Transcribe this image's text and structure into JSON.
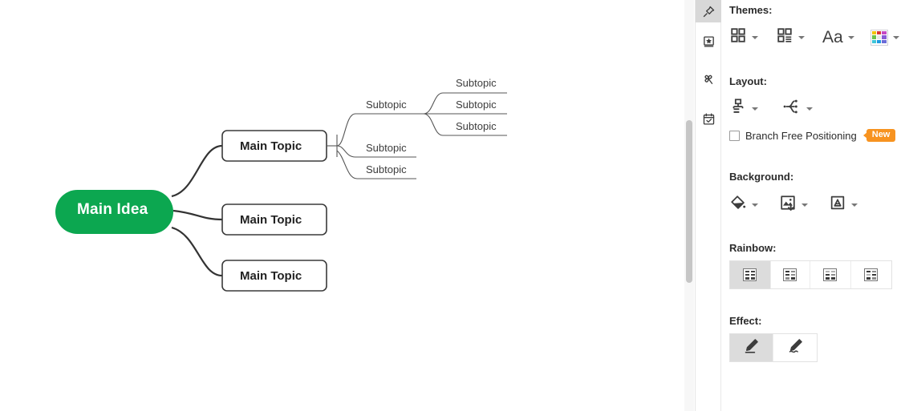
{
  "canvas": {
    "name": "mind-map-canvas",
    "center_node": {
      "label": "Main Idea",
      "fill": "#0ca750",
      "text_color": "#ffffff"
    },
    "main_topics": [
      {
        "label": "Main Topic"
      },
      {
        "label": "Main Topic"
      },
      {
        "label": "Main Topic"
      }
    ],
    "subtopics_level1": [
      {
        "label": "Subtopic"
      },
      {
        "label": "Subtopic"
      },
      {
        "label": "Subtopic"
      }
    ],
    "subtopics_level2": [
      {
        "label": "Subtopic"
      },
      {
        "label": "Subtopic"
      },
      {
        "label": "Subtopic"
      }
    ],
    "scrollbar": {
      "name": "canvas-vertical-scrollbar"
    }
  },
  "icon_rail": {
    "items": [
      {
        "icon": "pushpin-icon",
        "name": "rail-item-style",
        "active": true
      },
      {
        "icon": "book-star-icon",
        "name": "rail-item-outline",
        "active": false
      },
      {
        "icon": "clover-icon",
        "name": "rail-item-clipart",
        "active": false
      },
      {
        "icon": "calendar-check-icon",
        "name": "rail-item-task",
        "active": false
      }
    ]
  },
  "panel": {
    "themes": {
      "title": "Themes:",
      "items": [
        {
          "name": "theme-gallery",
          "icon": "four-squares-icon"
        },
        {
          "name": "theme-layout-variant",
          "icon": "squares-lines-icon"
        },
        {
          "name": "theme-font",
          "icon": "aa-icon",
          "label": "Aa"
        },
        {
          "name": "theme-color-palette",
          "icon": "color-palette-icon"
        }
      ],
      "palette_colors": [
        "#f2c200",
        "#d8363a",
        "#c648c4",
        "#6cc24a",
        "#e8e8e8",
        "#8a5ad6",
        "#3fc6d8",
        "#1f9ae0",
        "#6b6bd8"
      ]
    },
    "layout": {
      "title": "Layout:",
      "items": [
        {
          "name": "layout-structure",
          "icon": "org-chart-icon"
        },
        {
          "name": "layout-branch-shape",
          "icon": "tree-branch-icon"
        }
      ],
      "branch_free_positioning": {
        "label": "Branch Free Positioning",
        "checked": false,
        "badge": "New",
        "badge_color": "#f79320"
      }
    },
    "background": {
      "title": "Background:",
      "items": [
        {
          "name": "background-fill-color",
          "icon": "paint-bucket-icon"
        },
        {
          "name": "background-image",
          "icon": "image-download-icon"
        },
        {
          "name": "background-watermark",
          "icon": "watermark-icon"
        }
      ]
    },
    "rainbow": {
      "title": "Rainbow:",
      "options": [
        {
          "name": "rainbow-option-1",
          "icon": "grid-dark-icon",
          "active": true,
          "cells": [
            "#444444",
            "#444444",
            "#444444",
            "#444444",
            "#444444",
            "#444444"
          ]
        },
        {
          "name": "rainbow-option-2",
          "icon": "grid-mixed-a-icon",
          "active": false,
          "cells": [
            "#3a3a3a",
            "#8c8c8c",
            "#3a3a3a",
            "#8c8c8c",
            "#8c8c8c",
            "#3a3a3a"
          ]
        },
        {
          "name": "rainbow-option-3",
          "icon": "grid-mixed-b-icon",
          "active": false,
          "cells": [
            "#b4b4b4",
            "#b4b4b4",
            "#3a3a3a",
            "#8c8c8c",
            "#3a3a3a",
            "#3a3a3a"
          ]
        },
        {
          "name": "rainbow-option-4",
          "icon": "grid-mixed-c-icon",
          "active": false,
          "cells": [
            "#3a3a3a",
            "#8c8c8c",
            "#b4b4b4",
            "#3a3a3a",
            "#3a3a3a",
            "#8c8c8c"
          ]
        }
      ]
    },
    "effect": {
      "title": "Effect:",
      "options": [
        {
          "name": "effect-straight-line",
          "icon": "pencil-line-icon",
          "active": true
        },
        {
          "name": "effect-sketch-line",
          "icon": "pencil-squiggle-icon",
          "active": false
        }
      ]
    }
  }
}
